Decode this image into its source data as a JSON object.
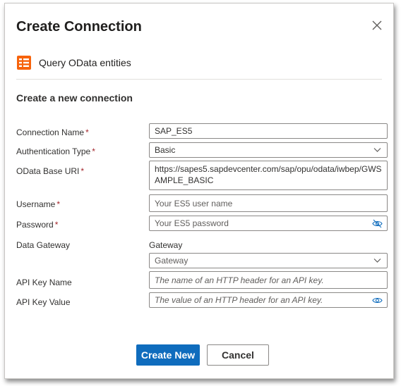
{
  "dialog": {
    "title": "Create Connection",
    "action": {
      "label": "Query OData entities",
      "icon": "table-list-icon",
      "icon_color": "#f7630c"
    },
    "section_title": "Create a new connection"
  },
  "form": {
    "required_mark": "*",
    "connection_name": {
      "label": "Connection Name",
      "value": "SAP_ES5"
    },
    "auth_type": {
      "label": "Authentication Type",
      "value": "Basic"
    },
    "odata_uri": {
      "label": "OData Base URI",
      "value": "https://sapes5.sapdevcenter.com/sap/opu/odata/iwbep/GWSAMPLE_BASIC"
    },
    "username": {
      "label": "Username",
      "placeholder": "Your ES5 user name"
    },
    "password": {
      "label": "Password",
      "placeholder": "Your ES5 password"
    },
    "data_gateway": {
      "label": "Data Gateway",
      "caption": "Gateway",
      "value": "Gateway"
    },
    "api_key_name": {
      "label": "API Key Name",
      "placeholder": "The name of an HTTP header for an API key."
    },
    "api_key_value": {
      "label": "API Key Value",
      "placeholder": "The value of an HTTP header for an API key."
    }
  },
  "buttons": {
    "create": "Create New",
    "cancel": "Cancel"
  },
  "colors": {
    "primary": "#0f6cbd",
    "required": "#a4262c",
    "eye_icon": "#0f6cbd"
  }
}
